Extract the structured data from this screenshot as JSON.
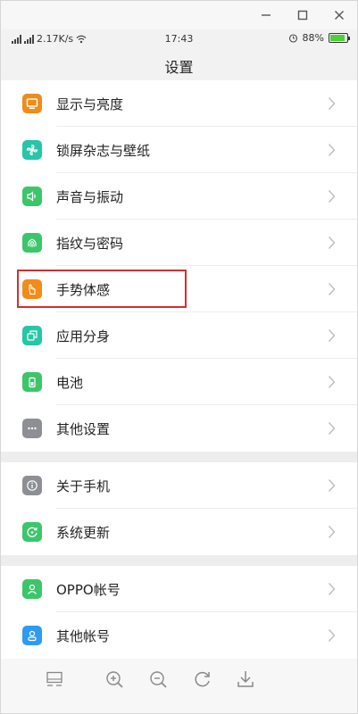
{
  "status_bar": {
    "network": "2.17K/s",
    "time": "17:43",
    "battery": "88%",
    "battery_level": 0.88
  },
  "header": {
    "title": "设置"
  },
  "sections": [
    {
      "items": [
        {
          "label": "显示与亮度",
          "icon": "display-icon",
          "color": "#f08c1a"
        },
        {
          "label": "锁屏杂志与壁纸",
          "icon": "pinwheel-icon",
          "color": "#26c6a6"
        },
        {
          "label": "声音与振动",
          "icon": "speaker-icon",
          "color": "#3cc66a"
        },
        {
          "label": "指纹与密码",
          "icon": "fingerprint-icon",
          "color": "#3cc66a"
        },
        {
          "label": "手势体感",
          "icon": "hand-gesture-icon",
          "color": "#f08c1a"
        },
        {
          "label": "应用分身",
          "icon": "app-clone-icon",
          "color": "#26c6a6"
        },
        {
          "label": "电池",
          "icon": "battery-icon",
          "color": "#3cc66a"
        },
        {
          "label": "其他设置",
          "icon": "more-icon",
          "color": "#8d8f94"
        }
      ]
    },
    {
      "items": [
        {
          "label": "关于手机",
          "icon": "info-icon",
          "color": "#8d8f94"
        },
        {
          "label": "系统更新",
          "icon": "update-icon",
          "color": "#3cc66a"
        }
      ]
    },
    {
      "items": [
        {
          "label": "OPPO帐号",
          "icon": "user-icon",
          "color": "#3cc66a"
        },
        {
          "label": "其他帐号",
          "icon": "account-icon",
          "color": "#2f9bf0"
        }
      ]
    }
  ],
  "toolbar": {
    "buttons": [
      "screen-icon",
      "zoom-in-icon",
      "zoom-out-icon",
      "rotate-icon",
      "download-icon"
    ]
  },
  "highlighted_item": "手势体感"
}
